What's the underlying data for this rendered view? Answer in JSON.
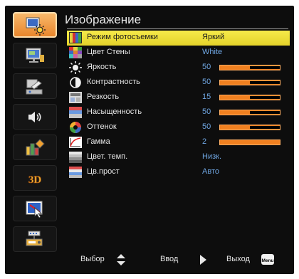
{
  "menu_title": "Изображение",
  "sidebar": [
    {
      "name": "image-settings-icon",
      "active": true
    },
    {
      "name": "display-settings-icon",
      "active": false
    },
    {
      "name": "setup-icon",
      "active": false
    },
    {
      "name": "volume-icon",
      "active": false
    },
    {
      "name": "options-icon",
      "active": false
    },
    {
      "name": "3d-icon",
      "active": false,
      "label": "3D"
    },
    {
      "name": "interactive-icon",
      "active": false
    },
    {
      "name": "lan-network-icon",
      "active": false
    }
  ],
  "rows": [
    {
      "label": "Режим фотосъемки",
      "value": "Яркий",
      "selected": true,
      "icon": "display-mode-icon"
    },
    {
      "label": "Цвет Стены",
      "value": "White",
      "icon": "wall-color-icon"
    },
    {
      "label": "Яркость",
      "value": "50",
      "level": 0.5,
      "icon": "brightness-icon"
    },
    {
      "label": "Контрастность",
      "value": "50",
      "level": 0.5,
      "icon": "contrast-icon"
    },
    {
      "label": "Резкость",
      "value": "15",
      "level": 0.5,
      "icon": "sharpness-icon"
    },
    {
      "label": "Насыщенность",
      "value": "50",
      "level": 0.5,
      "icon": "saturation-icon"
    },
    {
      "label": "Оттенок",
      "value": "50",
      "level": 0.5,
      "icon": "tint-icon"
    },
    {
      "label": "Гамма",
      "value": "2",
      "level": 1.0,
      "icon": "gamma-icon"
    },
    {
      "label": "Цвет. темп.",
      "value": "Низк.",
      "icon": "color-temp-icon"
    },
    {
      "label": "Цв.прост",
      "value": "Авто",
      "icon": "color-space-icon"
    }
  ],
  "footer": {
    "select_label": "Выбор",
    "enter_label": "Ввод",
    "exit_label": "Выход",
    "menu_key": "Menu"
  },
  "colors": {
    "accent": "#f08020",
    "selected_row": "#f0e040",
    "value_text": "#6fa6e2",
    "active_tab": "#f0a050"
  }
}
